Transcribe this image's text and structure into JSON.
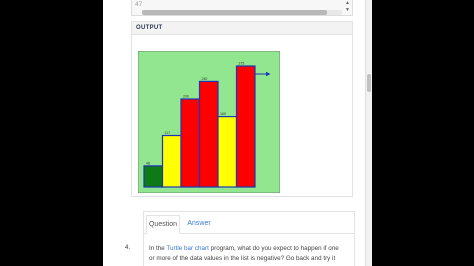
{
  "editor": {
    "line_number": "47"
  },
  "output": {
    "label": "OUTPUT"
  },
  "chart_data": {
    "type": "bar",
    "values": [
      48,
      117,
      200,
      240,
      160,
      275
    ],
    "bar_colors": [
      "green",
      "yellow",
      "red",
      "red",
      "yellow",
      "red"
    ],
    "ylim": [
      0,
      300
    ],
    "background": "lightgreen",
    "outline": "blue"
  },
  "tabs": {
    "question": "Question",
    "answer": "Answer"
  },
  "question": {
    "number": "4.",
    "text_before": "In the ",
    "link": "Turtle bar chart",
    "text_after": " program, what do you expect to happen if one or more of the data values in the list is negative? Go back and try it"
  },
  "colors": {
    "canvas_bg": "#92e68f",
    "outline": "#1b36b8",
    "red": "#ff0000",
    "yellow": "#ffff00",
    "green": "#0e7a16",
    "link": "#3a7bd5"
  }
}
